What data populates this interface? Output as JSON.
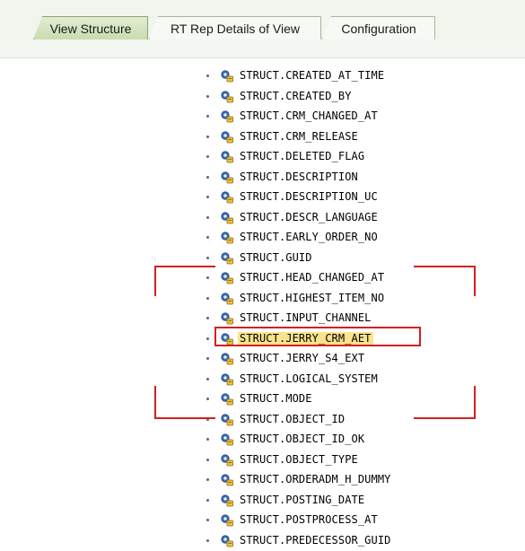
{
  "tabs": [
    {
      "label": "View Structure",
      "active": true
    },
    {
      "label": "RT Rep Details of View",
      "active": false
    },
    {
      "label": "Configuration",
      "active": false
    }
  ],
  "tree": {
    "icon": "structure-attribute-icon",
    "items": [
      "STRUCT.CREATED_AT_TIME",
      "STRUCT.CREATED_BY",
      "STRUCT.CRM_CHANGED_AT",
      "STRUCT.CRM_RELEASE",
      "STRUCT.DELETED_FLAG",
      "STRUCT.DESCRIPTION",
      "STRUCT.DESCRIPTION_UC",
      "STRUCT.DESCR_LANGUAGE",
      "STRUCT.EARLY_ORDER_NO",
      "STRUCT.GUID",
      "STRUCT.HEAD_CHANGED_AT",
      "STRUCT.HIGHEST_ITEM_NO",
      "STRUCT.INPUT_CHANNEL",
      "STRUCT.JERRY_CRM_AET",
      "STRUCT.JERRY_S4_EXT",
      "STRUCT.LOGICAL_SYSTEM",
      "STRUCT.MODE",
      "STRUCT.OBJECT_ID",
      "STRUCT.OBJECT_ID_OK",
      "STRUCT.OBJECT_TYPE",
      "STRUCT.ORDERADM_H_DUMMY",
      "STRUCT.POSTING_DATE",
      "STRUCT.POSTPROCESS_AT",
      "STRUCT.PREDECESSOR_GUID"
    ],
    "highlighted_item": "STRUCT.JERRY_CRM_AET"
  },
  "colors": {
    "active_tab": "#c9dcae",
    "highlight_fill": "#fbe38d",
    "annotation_red": "#d42020"
  }
}
